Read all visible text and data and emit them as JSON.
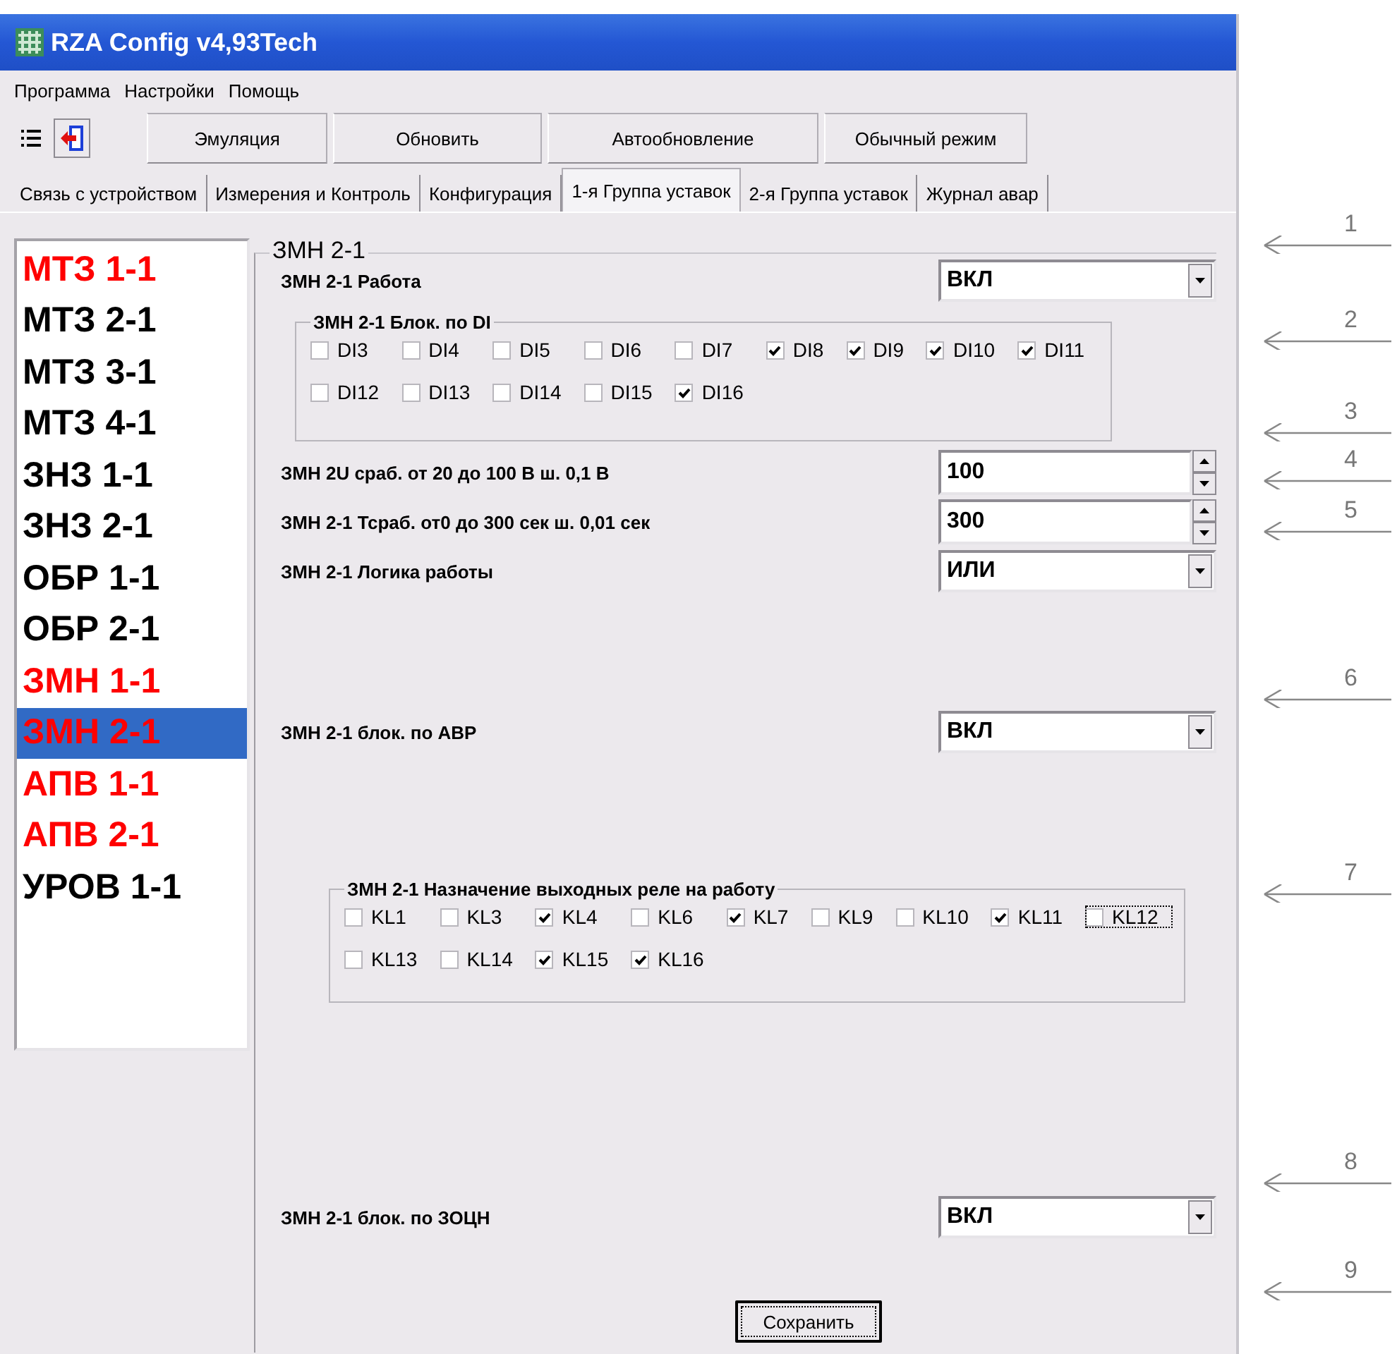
{
  "window": {
    "title": "RZA Config v4,93Tech"
  },
  "menu": [
    "Программа",
    "Настройки",
    "Помощь"
  ],
  "toolbar": {
    "buttons": [
      "Эмуляция",
      "Обновить",
      "Автообновление",
      "Обычный режим"
    ]
  },
  "tabs": [
    {
      "label": "Связь с устройством",
      "selected": false
    },
    {
      "label": "Измерения и Контроль",
      "selected": false
    },
    {
      "label": "Конфигурация",
      "selected": false
    },
    {
      "label": "1-я Группа уставок",
      "selected": true
    },
    {
      "label": "2-я Группа уставок",
      "selected": false
    },
    {
      "label": "Журнал авар",
      "selected": false
    }
  ],
  "sidebar": {
    "items": [
      {
        "label": "МТЗ 1-1",
        "color": "#ff0000",
        "selected": false
      },
      {
        "label": "МТЗ 2-1",
        "color": "#000000",
        "selected": false
      },
      {
        "label": "МТЗ 3-1",
        "color": "#000000",
        "selected": false
      },
      {
        "label": "МТЗ 4-1",
        "color": "#000000",
        "selected": false
      },
      {
        "label": "ЗНЗ 1-1",
        "color": "#000000",
        "selected": false
      },
      {
        "label": "ЗНЗ 2-1",
        "color": "#000000",
        "selected": false
      },
      {
        "label": "ОБР 1-1",
        "color": "#000000",
        "selected": false
      },
      {
        "label": "ОБР 2-1",
        "color": "#000000",
        "selected": false
      },
      {
        "label": "ЗМН 1-1",
        "color": "#ff0000",
        "selected": false
      },
      {
        "label": "ЗМН 2-1",
        "color": "#ff0000",
        "selected": true
      },
      {
        "label": "АПВ 1-1",
        "color": "#ff0000",
        "selected": false
      },
      {
        "label": "АПВ 2-1",
        "color": "#ff0000",
        "selected": false
      },
      {
        "label": "УРОВ 1-1",
        "color": "#000000",
        "selected": false
      }
    ]
  },
  "panel": {
    "title": "ЗМН 2-1",
    "rows": [
      {
        "kind": "dropdown",
        "label": "ЗМН 2-1 Работа",
        "value": "ВКЛ"
      },
      {
        "kind": "checkgroup",
        "title": "ЗМН 2-1 Блок. по DI",
        "items": [
          {
            "label": "DI3",
            "checked": false
          },
          {
            "label": "DI4",
            "checked": false
          },
          {
            "label": "DI5",
            "checked": false
          },
          {
            "label": "DI6",
            "checked": false
          },
          {
            "label": "DI7",
            "checked": false
          },
          {
            "label": "DI8",
            "checked": true
          },
          {
            "label": "DI9",
            "checked": true
          },
          {
            "label": "DI10",
            "checked": true
          },
          {
            "label": "DI11",
            "checked": true
          },
          {
            "label": "DI12",
            "checked": false
          },
          {
            "label": "DI13",
            "checked": false
          },
          {
            "label": "DI14",
            "checked": false
          },
          {
            "label": "DI15",
            "checked": false
          },
          {
            "label": "DI16",
            "checked": true
          }
        ]
      },
      {
        "kind": "spin",
        "label": "ЗМН 2U сраб. от 20 до 100 В ш. 0,1 В",
        "value": "100"
      },
      {
        "kind": "spin",
        "label": "ЗМН 2-1 Тсраб. от0 до 300 сек ш. 0,01 сек",
        "value": "300"
      },
      {
        "kind": "dropdown",
        "label": "ЗМН 2-1 Логика работы",
        "value": "ИЛИ"
      },
      {
        "kind": "dropdown",
        "label": "ЗМН 2-1 блок. по АВР",
        "value": "ВКЛ"
      },
      {
        "kind": "checkgroup",
        "title": "ЗМН 2-1 Назначение выходных реле на работу",
        "items": [
          {
            "label": "KL1",
            "checked": false,
            "focused": false
          },
          {
            "label": "KL3",
            "checked": false,
            "focused": false
          },
          {
            "label": "KL4",
            "checked": true,
            "focused": false
          },
          {
            "label": "KL6",
            "checked": false,
            "focused": false
          },
          {
            "label": "KL7",
            "checked": true,
            "focused": false
          },
          {
            "label": "KL9",
            "checked": false,
            "focused": false
          },
          {
            "label": "KL10",
            "checked": false,
            "focused": false
          },
          {
            "label": "KL11",
            "checked": true,
            "focused": false
          },
          {
            "label": "KL12",
            "checked": false,
            "focused": true
          },
          {
            "label": "KL13",
            "checked": false,
            "focused": false
          },
          {
            "label": "KL14",
            "checked": false,
            "focused": false
          },
          {
            "label": "KL15",
            "checked": true,
            "focused": false
          },
          {
            "label": "KL16",
            "checked": true,
            "focused": false
          }
        ]
      },
      {
        "kind": "dropdown",
        "label": "ЗМН 2-1 блок. по ЗОЦН",
        "value": "ВКЛ"
      },
      {
        "kind": "button",
        "label": "Сохранить",
        "focused": true
      }
    ]
  },
  "callouts": [
    "1",
    "2",
    "3",
    "4",
    "5",
    "6",
    "7",
    "8",
    "9"
  ]
}
